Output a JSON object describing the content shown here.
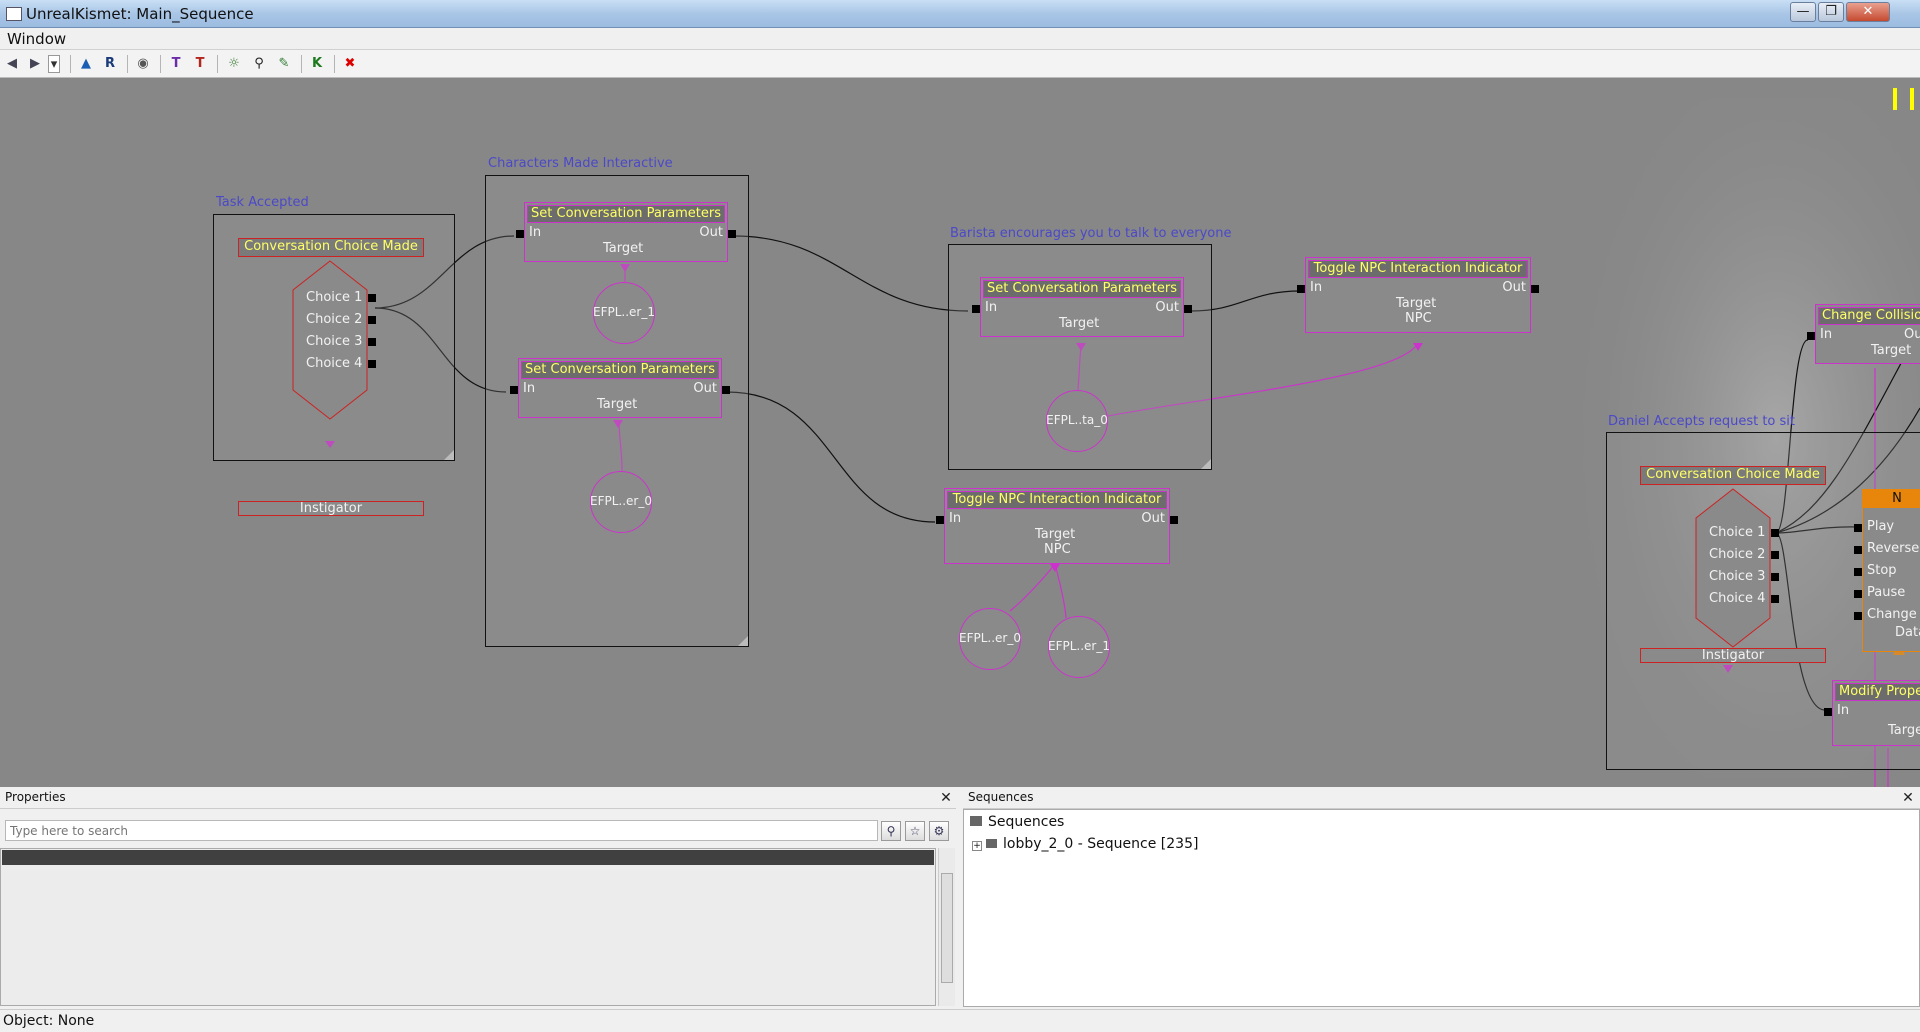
{
  "window": {
    "title": "UnrealKismet: Main_Sequence",
    "minimize": "—",
    "maximize": "❐",
    "close": "✕"
  },
  "menu": {
    "window": "Window"
  },
  "toolbar": [
    {
      "name": "back-icon",
      "glyph": "◀"
    },
    {
      "name": "forward-icon",
      "glyph": "▶"
    },
    {
      "name": "history-dropdown-icon",
      "glyph": "▾"
    },
    {
      "name": "parent-sequence-icon",
      "glyph": "▲"
    },
    {
      "name": "rename-icon",
      "glyph": "R"
    },
    {
      "name": "eye-icon",
      "glyph": "◉"
    },
    {
      "name": "open-new-window-icon",
      "glyph": "T"
    },
    {
      "name": "open-new-window-2-icon",
      "glyph": "T"
    },
    {
      "name": "lightbulb-icon",
      "glyph": "☼"
    },
    {
      "name": "search-icon",
      "glyph": "⚲"
    },
    {
      "name": "wrench-icon",
      "glyph": "✎"
    },
    {
      "name": "kismet-icon",
      "glyph": "K"
    },
    {
      "name": "stop-icon",
      "glyph": "✖"
    }
  ],
  "canvas": {
    "comments": {
      "task_accepted": "Task Accepted",
      "characters_interactive": "Characters Made Interactive",
      "barista": "Barista encourages you to talk to everyone",
      "daniel": "Daniel Accepts request to sit"
    },
    "events": {
      "choice_made_1": {
        "title": "Conversation Choice Made",
        "choices": [
          "Choice 1",
          "Choice 2",
          "Choice 3",
          "Choice 4"
        ],
        "instigator": "Instigator"
      },
      "choice_made_2": {
        "title": "Conversation Choice Made",
        "choices": [
          "Choice 1",
          "Choice 2",
          "Choice 3",
          "Choice 4"
        ],
        "instigator": "Instigator"
      }
    },
    "nodes": {
      "set_conv_1": {
        "title": "Set Conversation Parameters",
        "in": "In",
        "out": "Out",
        "target": "Target"
      },
      "set_conv_2": {
        "title": "Set Conversation Parameters",
        "in": "In",
        "out": "Out",
        "target": "Target"
      },
      "set_conv_3": {
        "title": "Set Conversation Parameters",
        "in": "In",
        "out": "Out",
        "target": "Target"
      },
      "toggle_npc_1": {
        "title": "Toggle NPC Interaction Indicator",
        "in": "In",
        "out": "Out",
        "target": "Target",
        "npc": "NPC"
      },
      "toggle_npc_2": {
        "title": "Toggle NPC Interaction Indicator",
        "in": "In",
        "out": "Out",
        "target": "Target",
        "npc": "NPC"
      },
      "change_collision": {
        "title": "Change Collisio",
        "in": "In",
        "out": "Ou",
        "target": "Target"
      },
      "matinee": {
        "title": "N",
        "inputs": [
          "Play",
          "Reverse",
          "Stop",
          "Pause",
          "Change"
        ],
        "data": "Data"
      },
      "modify_property": {
        "title": "Modify Prope",
        "in": "In",
        "target": "Target"
      }
    },
    "vars": {
      "efpl_er_1_a": "EFPL..er_1",
      "efpl_er_0_a": "EFPL..er_0",
      "efpl_ta_0": "EFPL..ta_0",
      "efpl_er_0_b": "EFPL..er_0",
      "efpl_er_1_b": "EFPL..er_1"
    }
  },
  "properties": {
    "title": "Properties",
    "close": "✕",
    "search_placeholder": "Type here to search"
  },
  "sequences": {
    "title": "Sequences",
    "close": "✕",
    "root": "Sequences",
    "expand": "+",
    "item": "lobby_2_0 - Sequence [235]"
  },
  "status": {
    "text": "Object: None"
  }
}
